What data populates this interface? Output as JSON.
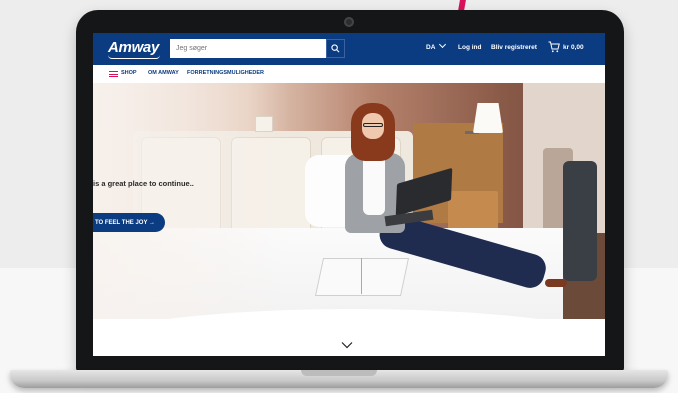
{
  "header": {
    "logo": "Amway",
    "search_placeholder": "Jeg søger",
    "language": "DA",
    "login": "Log ind",
    "register": "Bliv registreret",
    "cart_total": "kr 0,00"
  },
  "nav": {
    "items": [
      "SHOP",
      "OM AMWAY",
      "FORRETNINGSMULIGHEDER"
    ]
  },
  "hero": {
    "headline": "is a great place to continue..",
    "cta": "TO FEEL THE JOY →"
  },
  "colors": {
    "brand_blue": "#0b3b80",
    "accent_pink": "#d8115d"
  },
  "icons": [
    "search-icon",
    "chevron-down-icon",
    "cart-icon",
    "menu-icon",
    "scroll-down-icon"
  ]
}
